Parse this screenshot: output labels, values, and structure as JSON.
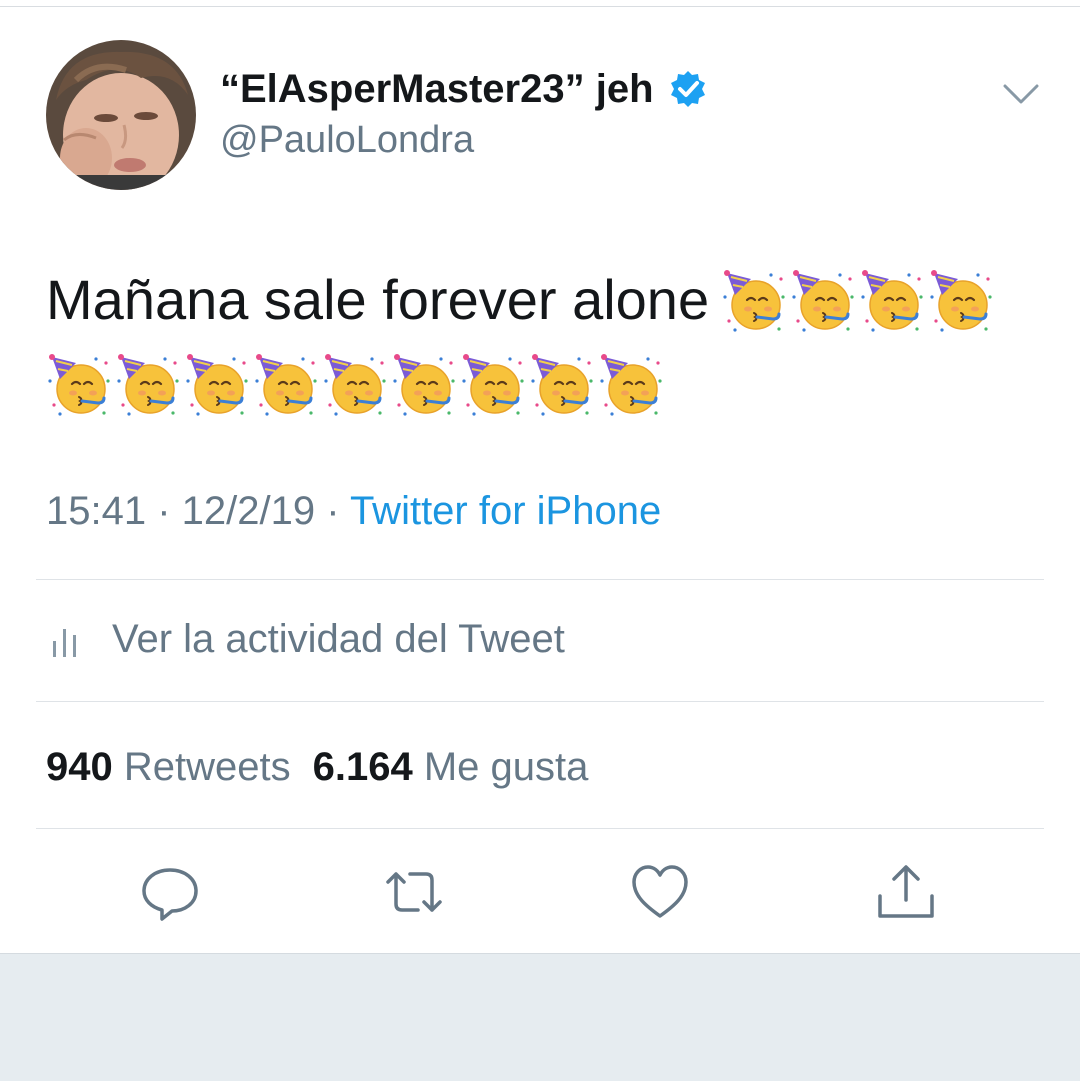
{
  "user": {
    "display_name": "“ElAsperMaster23” jeh",
    "handle": "@PauloLondra",
    "verified_icon": "verified-badge-icon",
    "verified_color": "#1da1f2"
  },
  "tweet": {
    "text": "Mañana sale forever alone",
    "emoji": "partying-face-emoji",
    "emoji_count_line1": 4,
    "emoji_count_line2": 9
  },
  "meta": {
    "time": "15:41",
    "separator": " · ",
    "date": "12/2/19",
    "source": "Twitter for iPhone"
  },
  "activity": {
    "label": "Ver la actividad del Tweet",
    "icon": "analytics-bars-icon"
  },
  "stats": {
    "retweets_count": "940",
    "retweets_label": "Retweets",
    "likes_count": "6.164",
    "likes_label": "Me gusta"
  },
  "actions": {
    "icons": [
      "reply-icon",
      "retweet-icon",
      "like-icon",
      "share-icon"
    ]
  },
  "colors": {
    "text": "#14171a",
    "secondary": "#657786",
    "link": "#1b95e0",
    "divider": "#dfe3e7",
    "background_below": "#e6ecf0"
  }
}
